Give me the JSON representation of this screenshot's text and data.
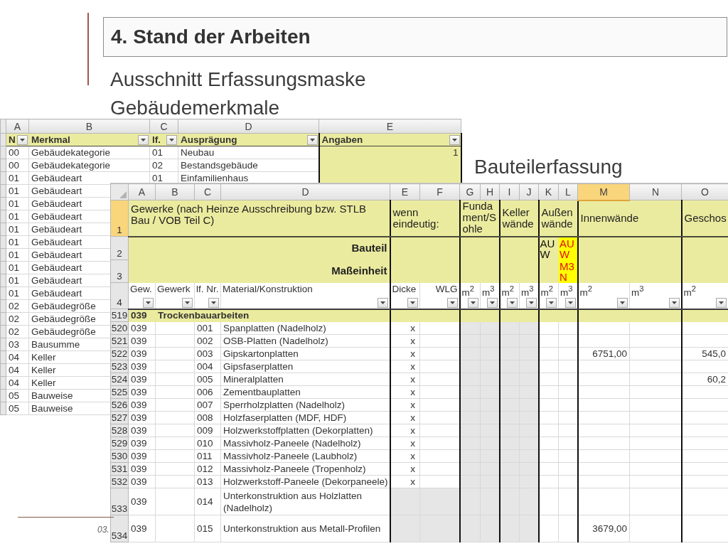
{
  "slide": {
    "title": "4. Stand der Arbeiten",
    "subtitle": "Ausschnitt Erfassungsmaske",
    "footer": "03."
  },
  "merkmal_sheet": {
    "caption": "Gebäudemerkmale",
    "columns": [
      "A",
      "B",
      "C",
      "D",
      "E"
    ],
    "headers": [
      "N",
      "Merkmal",
      "lf.",
      "Ausprägung",
      "Angaben"
    ],
    "rows": [
      {
        "nr": "00",
        "merkmal": "Gebäudekategorie",
        "lf_nr": "01",
        "auspraegung": "Neubau",
        "angaben": "1"
      },
      {
        "nr": "00",
        "merkmal": "Gebäudekategorie",
        "lf_nr": "02",
        "auspraegung": "Bestandsgebäude"
      },
      {
        "nr": "01",
        "merkmal": "Gebäudeart",
        "lf_nr": "01",
        "auspraegung": "Einfamilienhaus"
      },
      {
        "nr": "01",
        "merkmal": "Gebäudeart"
      },
      {
        "nr": "01",
        "merkmal": "Gebäudeart"
      },
      {
        "nr": "01",
        "merkmal": "Gebäudeart"
      },
      {
        "nr": "01",
        "merkmal": "Gebäudeart"
      },
      {
        "nr": "01",
        "merkmal": "Gebäudeart"
      },
      {
        "nr": "01",
        "merkmal": "Gebäudeart"
      },
      {
        "nr": "01",
        "merkmal": "Gebäudeart"
      },
      {
        "nr": "01",
        "merkmal": "Gebäudeart"
      },
      {
        "nr": "01",
        "merkmal": "Gebäudeart"
      },
      {
        "nr": "02",
        "merkmal": "Gebäudegröße"
      },
      {
        "nr": "02",
        "merkmal": "Gebäudegröße"
      },
      {
        "nr": "02",
        "merkmal": "Gebäudegröße"
      },
      {
        "nr": "03",
        "merkmal": "Bausumme"
      },
      {
        "nr": "04",
        "merkmal": "Keller"
      },
      {
        "nr": "04",
        "merkmal": "Keller"
      },
      {
        "nr": "04",
        "merkmal": "Keller"
      },
      {
        "nr": "05",
        "merkmal": "Bauweise"
      },
      {
        "nr": "05",
        "merkmal": "Bauweise"
      }
    ]
  },
  "bauteil_sheet": {
    "caption": "Bauteilerfassung",
    "columns": [
      {
        "letter": "A",
        "selected": false
      },
      {
        "letter": "B",
        "selected": false
      },
      {
        "letter": "C",
        "selected": false
      },
      {
        "letter": "D",
        "selected": false
      },
      {
        "letter": "E",
        "selected": false
      },
      {
        "letter": "F",
        "selected": false
      },
      {
        "letter": "G",
        "selected": false
      },
      {
        "letter": "H",
        "selected": false
      },
      {
        "letter": "I",
        "selected": false
      },
      {
        "letter": "J",
        "selected": false
      },
      {
        "letter": "K",
        "selected": false
      },
      {
        "letter": "L",
        "selected": false
      },
      {
        "letter": "M",
        "selected": true
      },
      {
        "letter": "N",
        "selected": false
      },
      {
        "letter": "O",
        "selected": false
      }
    ],
    "header_row_1": {
      "number": "1",
      "selected": true,
      "cells": [
        "Gewerke (nach Heinze Ausschreibung bzw. STLB Bau / VOB Teil C)",
        "wenn eindeutig:",
        "Fundament/Sohle",
        "Keller wände",
        "Außen wände",
        "Innenwände",
        "Geschos"
      ]
    },
    "header_row_2": {
      "number": "2",
      "selected": false,
      "label": "Bauteil",
      "code_k": {
        "text": "AUW",
        "highlight": false
      },
      "code_l": {
        "text": "AUW",
        "highlight": true
      }
    },
    "header_row_3": {
      "number": "3",
      "selected": false,
      "label": "Maßeinheit",
      "code_l": {
        "text": "M3N",
        "highlight": true
      }
    },
    "header_row_4": {
      "number": "4",
      "selected": false,
      "cells": [
        "Gew.",
        "Gewerk",
        "lf. Nr.",
        "Material/Konstruktion",
        "Dicke",
        "WLG",
        "m$^{2}$",
        "m$^{3}$",
        "m$^{2}$",
        "m$^{3}$",
        "m$^{2}$",
        "m$^{3}$",
        "m$^{2}$",
        "m$^{3}$",
        "m$^{2}$"
      ]
    },
    "rows": [
      {
        "number": "519",
        "selected": false,
        "kind": "group",
        "gew": "039",
        "label": "Trockenbauarbeiten"
      },
      {
        "number": "520",
        "selected": false,
        "kind": "item",
        "gew": "039",
        "nr": "001",
        "material": "Spanplatten (Nadelholz)",
        "dicke": "x"
      },
      {
        "number": "521",
        "selected": false,
        "kind": "item",
        "gew": "039",
        "nr": "002",
        "material": "OSB-Platten (Nadelholz)",
        "dicke": "x"
      },
      {
        "number": "522",
        "selected": false,
        "kind": "item",
        "gew": "039",
        "nr": "003",
        "material": "Gipskartonplatten",
        "dicke": "x",
        "innenwaende_m2": "6751,00",
        "column_o": "545,0"
      },
      {
        "number": "523",
        "selected": false,
        "kind": "item",
        "gew": "039",
        "nr": "004",
        "material": "Gipsfaserplatten",
        "dicke": "x"
      },
      {
        "number": "524",
        "selected": false,
        "kind": "item",
        "gew": "039",
        "nr": "005",
        "material": "Mineralplatten",
        "dicke": "x",
        "column_o": "60,2"
      },
      {
        "number": "525",
        "selected": false,
        "kind": "item",
        "gew": "039",
        "nr": "006",
        "material": "Zementbauplatten",
        "dicke": "x"
      },
      {
        "number": "526",
        "selected": false,
        "kind": "item",
        "gew": "039",
        "nr": "007",
        "material": "Sperrholzplatten (Nadelholz)",
        "dicke": "x"
      },
      {
        "number": "527",
        "selected": false,
        "kind": "item",
        "gew": "039",
        "nr": "008",
        "material": "Holzfaserplatten (MDF, HDF)",
        "dicke": "x"
      },
      {
        "number": "528",
        "selected": false,
        "kind": "item",
        "gew": "039",
        "nr": "009",
        "material": "Holzwerkstoffplatten (Dekorplatten)",
        "dicke": "x"
      },
      {
        "number": "529",
        "selected": false,
        "kind": "item",
        "gew": "039",
        "nr": "010",
        "material": "Massivholz-Paneele (Nadelholz)",
        "dicke": "x"
      },
      {
        "number": "530",
        "selected": false,
        "kind": "item",
        "gew": "039",
        "nr": "011",
        "material": "Massivholz-Paneele (Laubholz)",
        "dicke": "x"
      },
      {
        "number": "531",
        "selected": false,
        "kind": "item",
        "gew": "039",
        "nr": "012",
        "material": "Massivholz-Paneele (Tropenholz)",
        "dicke": "x"
      },
      {
        "number": "532",
        "selected": false,
        "kind": "item",
        "gew": "039",
        "nr": "013",
        "material": "Holzwerkstoff-Paneele (Dekorpaneele)",
        "dicke": "x"
      },
      {
        "number": "533",
        "selected": false,
        "kind": "item",
        "gew": "039",
        "nr": "014",
        "material": "Unterkonstruktion aus Holzlatten (Nadelholz)"
      },
      {
        "number": "534",
        "selected": false,
        "kind": "item",
        "gew": "039",
        "nr": "015",
        "material": "Unterkonstruktion aus Metall-Profilen",
        "innenwaende_m2": "3679,00"
      }
    ]
  }
}
